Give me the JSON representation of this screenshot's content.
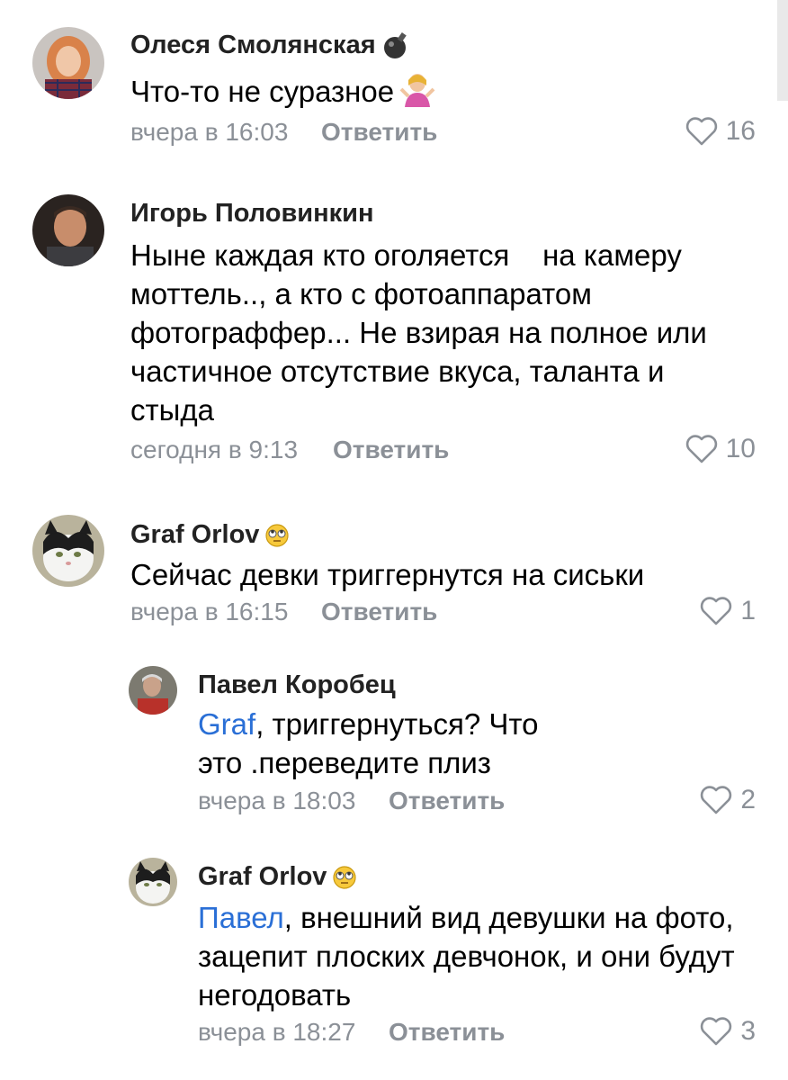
{
  "comments": [
    {
      "author": "Олеся Смолянская",
      "author_emoji": "bomb-emoji",
      "text": "Что-то не суразное",
      "text_emoji": "person-shrugging-emoji",
      "time": "вчера в 16:03",
      "reply_label": "Ответить",
      "likes": "16"
    },
    {
      "author": "Игорь Половинкин",
      "text_lines": [
        "Ныне каждая кто оголяется    на камеру",
        "моттель.., а кто с фотоаппаратом",
        "фотограффер... Не взирая на полное или",
        "частичное отсутствие вкуса, таланта и",
        "стыда"
      ],
      "time": "сегодня в 9:13",
      "reply_label": "Ответить",
      "likes": "10"
    },
    {
      "author": "Graf Orlov",
      "author_emoji": "face-with-rolling-eyes-emoji",
      "text": "Сейчас девки триггернутся на сиськи",
      "time": "вчера в 16:15",
      "reply_label": "Ответить",
      "likes": "1"
    },
    {
      "author": "Павел Коробец",
      "mention": "Graf",
      "text_first": ", триггернуться? Что",
      "text_second": "это .переведите плиз",
      "time": "вчера в 18:03",
      "reply_label": "Ответить",
      "likes": "2"
    },
    {
      "author": "Graf Orlov",
      "author_emoji": "face-with-rolling-eyes-emoji",
      "mention": "Павел",
      "text_first": ", внешний вид девушки на фото,",
      "text_lines": [
        "зацепит плоских девчонок, и они будут",
        "негодовать"
      ],
      "time": "вчера в 18:27",
      "reply_label": "Ответить",
      "likes": "3"
    }
  ],
  "colors": {
    "mention": "#2a6fd6",
    "meta": "#8b9097"
  },
  "icons": {
    "like": "heart-outline-icon"
  }
}
